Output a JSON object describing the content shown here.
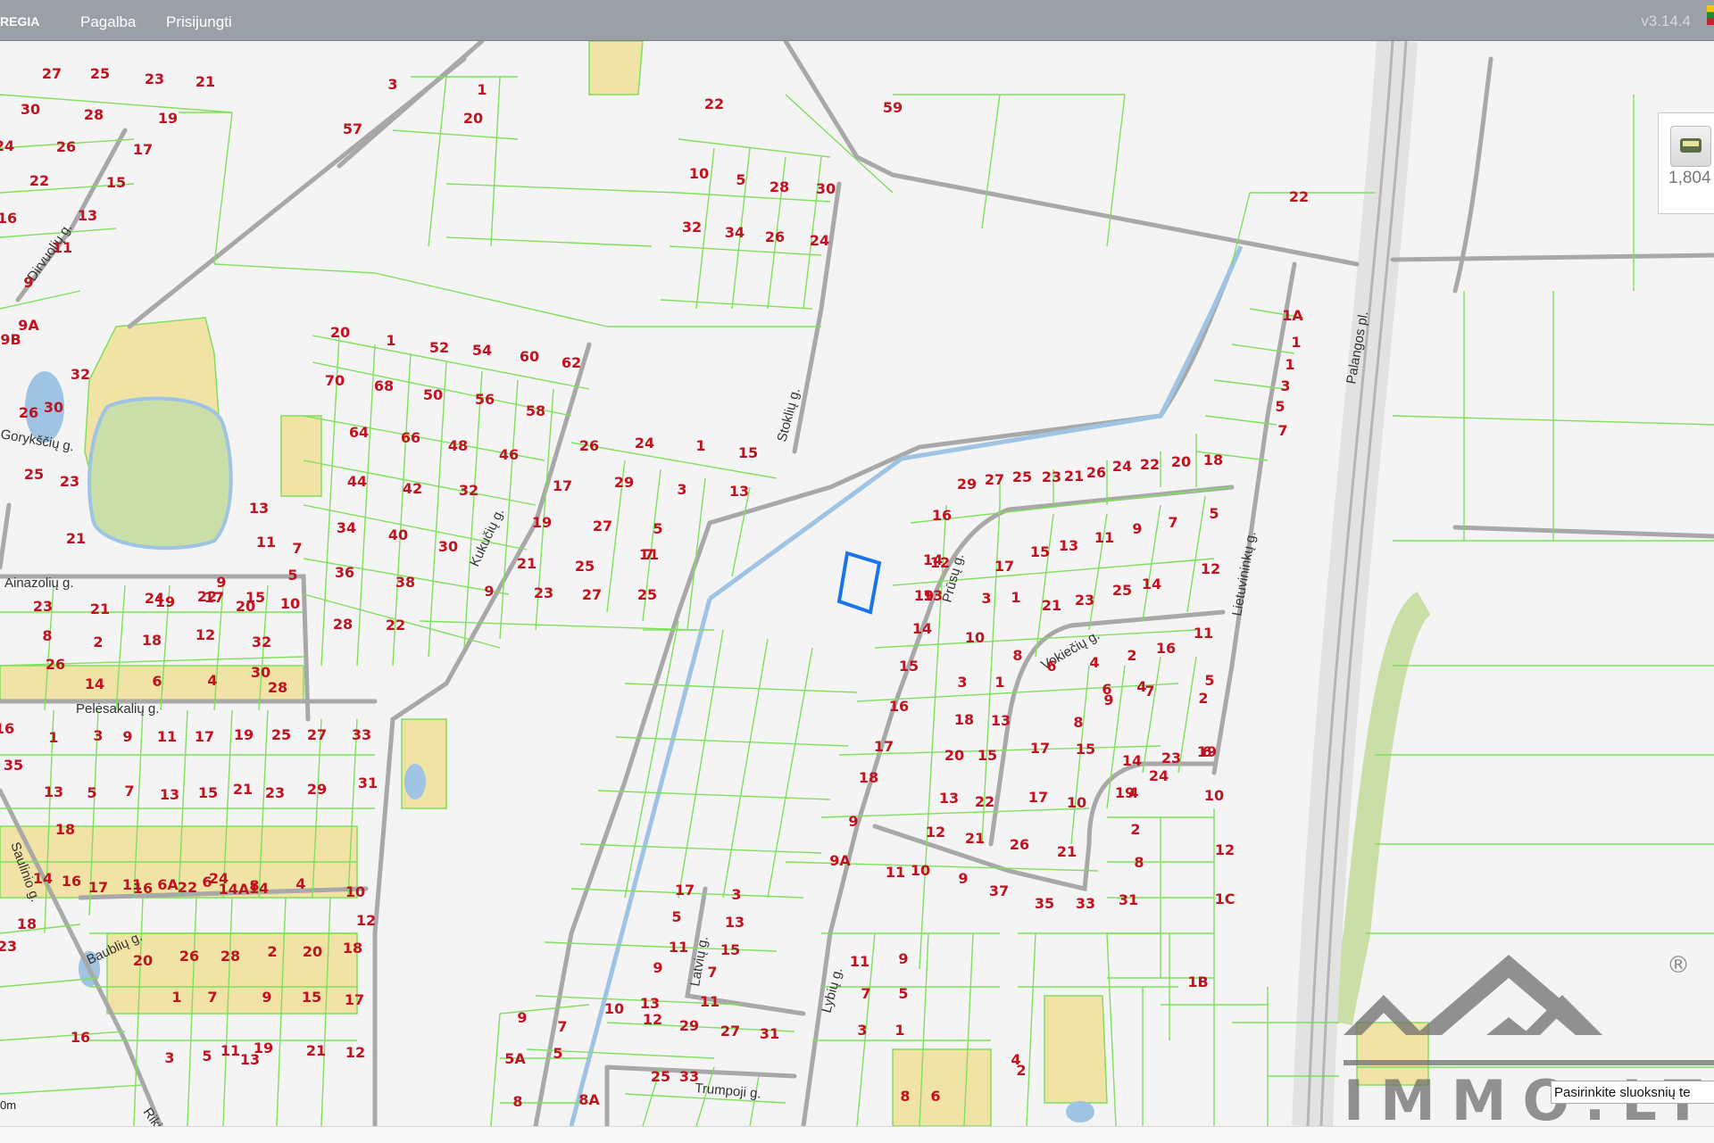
{
  "topbar": {
    "brand": "REGIA",
    "menu": [
      "Pagalba",
      "Prisijungti"
    ],
    "version": "v3.14.4"
  },
  "layer_control": {
    "count": "1,804"
  },
  "hint": "Pasirinkite sluoksnių te",
  "scale_label": "0m",
  "logo": {
    "text": "IMMO.LT",
    "registered": "®"
  },
  "colors": {
    "parcel_line": "#7ee05b",
    "road": "#a8a8a8",
    "water": "#9ec3e3",
    "building_zone": "#f1e3a6",
    "label": "#c0121f",
    "selection": "#1a73e8"
  },
  "streets": [
    "Dirvuolių g.",
    "Gorykščių g.",
    "Ainazolių g.",
    "Pelėsakalių g.",
    "Saulinio g.",
    "Baublių g.",
    "Kukučių g.",
    "Stoklių g.",
    "Prūsų g.",
    "Vokiečių g.",
    "Lietuvininkų g.",
    "Palangos pl.",
    "Latvių g.",
    "Lybių g.",
    "Trumpoji g.",
    "Rikių g."
  ],
  "parcel_numbers": [
    "27",
    "25",
    "23",
    "21",
    "30",
    "28",
    "19",
    "24",
    "26",
    "17",
    "22",
    "15",
    "16",
    "13",
    "11",
    "9",
    "9A",
    "9B",
    "32",
    "30",
    "26",
    "25",
    "23",
    "21",
    "19",
    "17",
    "15",
    "13",
    "11",
    "9",
    "7",
    "5",
    "3",
    "1",
    "57",
    "20",
    "22",
    "59",
    "10",
    "5",
    "28",
    "30",
    "32",
    "34",
    "26",
    "24",
    "22",
    "20",
    "1",
    "52",
    "54",
    "60",
    "62",
    "70",
    "68",
    "50",
    "56",
    "58",
    "64",
    "66",
    "48",
    "46",
    "44",
    "42",
    "32",
    "34",
    "40",
    "30",
    "36",
    "38",
    "28",
    "22",
    "26",
    "24",
    "1",
    "15",
    "17",
    "29",
    "3",
    "13",
    "19",
    "27",
    "5",
    "11",
    "21",
    "25",
    "7",
    "9",
    "23",
    "27",
    "25",
    "23",
    "21",
    "24",
    "22",
    "20",
    "10",
    "8",
    "2",
    "18",
    "12",
    "32",
    "26",
    "14",
    "6",
    "4",
    "30",
    "28",
    "16",
    "1",
    "3",
    "9",
    "11",
    "17",
    "19",
    "25",
    "27",
    "33",
    "35",
    "13",
    "5",
    "7",
    "13",
    "15",
    "21",
    "23",
    "29",
    "31",
    "18",
    "16",
    "17",
    "11",
    "6A",
    "6",
    "8",
    "14",
    "16",
    "22",
    "24",
    "14A",
    "14",
    "4",
    "10",
    "12",
    "18",
    "20",
    "26",
    "28",
    "2",
    "20",
    "18",
    "1",
    "7",
    "9",
    "15",
    "17",
    "23",
    "16",
    "3",
    "5",
    "11",
    "13",
    "19",
    "21",
    "12",
    "9",
    "7",
    "5A",
    "5",
    "8A",
    "8",
    "10",
    "12",
    "29",
    "27",
    "31",
    "25",
    "33",
    "11",
    "9",
    "7",
    "5",
    "3",
    "1",
    "8",
    "6",
    "4",
    "2",
    "17",
    "3",
    "5",
    "13",
    "11",
    "15",
    "9",
    "7",
    "13",
    "11",
    "9A",
    "9",
    "18",
    "17",
    "16",
    "15",
    "14",
    "13",
    "12",
    "11",
    "10",
    "9",
    "37",
    "35",
    "33",
    "31",
    "29",
    "27",
    "25",
    "23",
    "21",
    "26",
    "24",
    "22",
    "20",
    "18",
    "16",
    "14",
    "19",
    "17",
    "15",
    "13",
    "11",
    "9",
    "7",
    "5",
    "3",
    "1",
    "21",
    "23",
    "25",
    "14",
    "12",
    "10",
    "8",
    "6",
    "4",
    "2",
    "16",
    "11",
    "9",
    "7",
    "5",
    "3",
    "1",
    "18",
    "13",
    "8",
    "6",
    "4",
    "2",
    "20",
    "15",
    "17",
    "15",
    "13",
    "22",
    "17",
    "10",
    "19",
    "24",
    "19",
    "12",
    "21",
    "26",
    "21",
    "14",
    "23",
    "6",
    "4",
    "2",
    "8",
    "10",
    "12",
    "1C",
    "1B",
    "1A",
    "1",
    "1",
    "3",
    "5",
    "7",
    "9",
    "11"
  ]
}
